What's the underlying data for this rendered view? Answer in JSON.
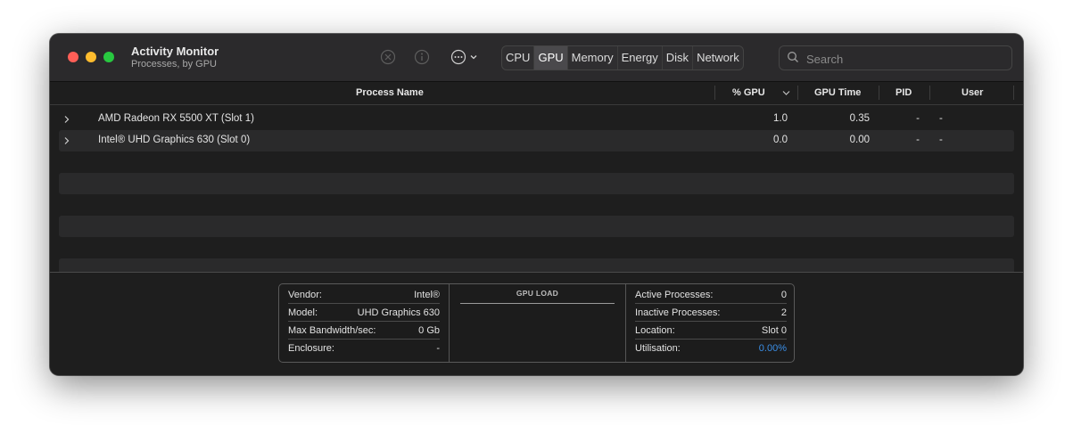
{
  "window": {
    "title": "Activity Monitor",
    "subtitle": "Processes, by GPU"
  },
  "toolbar": {
    "tabs": [
      "CPU",
      "GPU",
      "Memory",
      "Energy",
      "Disk",
      "Network"
    ],
    "active_tab": "GPU",
    "icons": [
      "stop-icon",
      "info-icon",
      "more-icon",
      "chevron-down-icon"
    ]
  },
  "search": {
    "placeholder": "Search"
  },
  "table": {
    "columns": {
      "process_name": "Process Name",
      "gpu_percent": "% GPU",
      "gpu_time": "GPU Time",
      "pid": "PID",
      "user": "User"
    },
    "sort_column": "% GPU",
    "rows": [
      {
        "name": "AMD Radeon RX 5500 XT (Slot 1)",
        "gpu": "1.0",
        "time": "0.35",
        "pid": "-",
        "user": "-"
      },
      {
        "name": "Intel® UHD Graphics 630 (Slot 0)",
        "gpu": "0.0",
        "time": "0.00",
        "pid": "-",
        "user": "-"
      }
    ]
  },
  "info": {
    "vendor_label": "Vendor:",
    "vendor": "Intel®",
    "model_label": "Model:",
    "model": "UHD Graphics 630",
    "bandwidth_label": "Max Bandwidth/sec:",
    "bandwidth": "0 Gb",
    "enclosure_label": "Enclosure:",
    "enclosure": "-",
    "gpu_load_title": "GPU LOAD",
    "active_label": "Active Processes:",
    "active": "0",
    "inactive_label": "Inactive Processes:",
    "inactive": "2",
    "location_label": "Location:",
    "location": "Slot 0",
    "util_label": "Utilisation:",
    "util": "0.00%"
  },
  "colors": {
    "close": "#ff5f57",
    "minimize": "#febc2e",
    "zoom": "#28c840",
    "utilisation": "#3a8ee6"
  }
}
